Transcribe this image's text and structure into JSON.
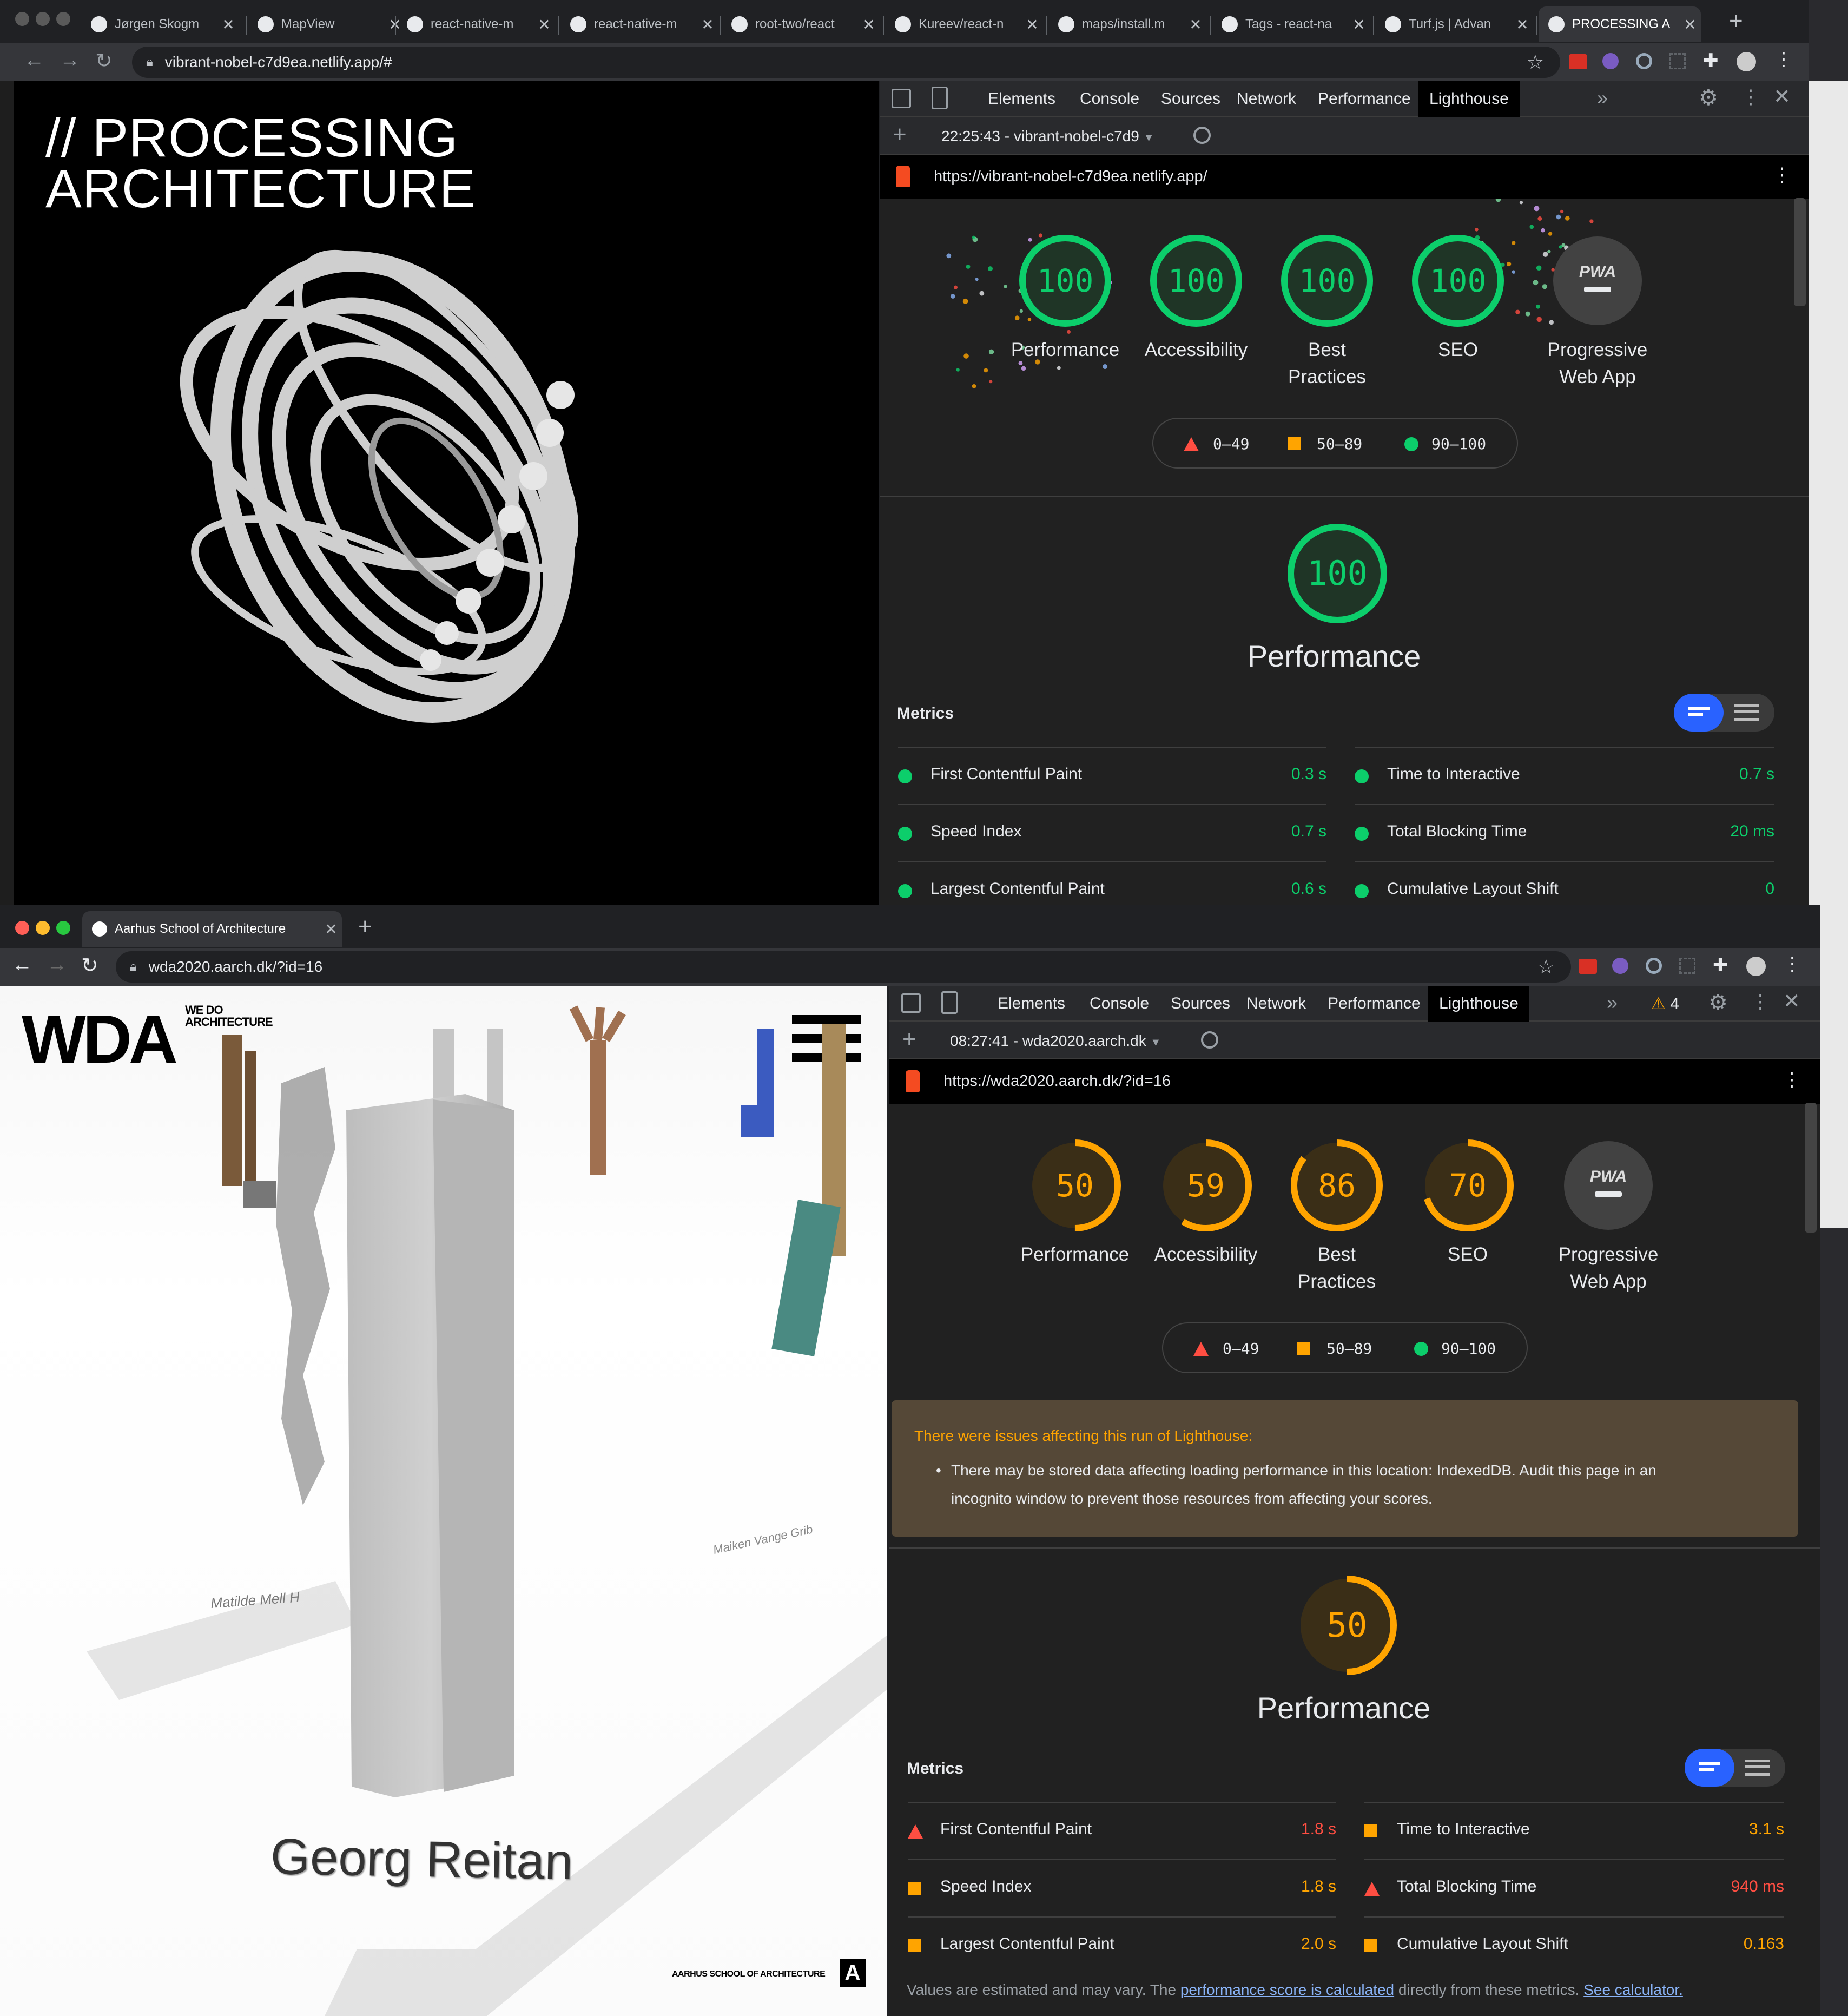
{
  "window_top": {
    "tabs": [
      {
        "label": "Jørgen Skogm",
        "icon": "gitlab-icon"
      },
      {
        "label": "MapView",
        "icon": "react-icon"
      },
      {
        "label": "react-native-m",
        "icon": "github-icon"
      },
      {
        "label": "react-native-m",
        "icon": "github-icon"
      },
      {
        "label": "root-two/react",
        "icon": "github-icon"
      },
      {
        "label": "Kureev/react-n",
        "icon": "github-icon"
      },
      {
        "label": "maps/install.m",
        "icon": "github-icon"
      },
      {
        "label": "Tags - react-na",
        "icon": "github-icon"
      },
      {
        "label": "Turf.js | Advan",
        "icon": "turf-icon"
      },
      {
        "label": "PROCESSING A",
        "icon": "square-icon"
      }
    ],
    "url": "vibrant-nobel-c7d9ea.netlify.app/#",
    "page": {
      "title_line1": "// PROCESSING",
      "title_line2": "ARCHITECTURE"
    },
    "devtools": {
      "tabs": [
        "Elements",
        "Console",
        "Sources",
        "Network",
        "Performance",
        "Lighthouse"
      ],
      "active_tab": "Lighthouse",
      "report_time": "22:25:43 - vibrant-nobel-c7d9",
      "report_url": "https://vibrant-nobel-c7d9ea.netlify.app/",
      "scores": [
        {
          "value": "100",
          "label1": "Performance",
          "label2": "",
          "color": "#0cce6b",
          "fraction": 1.0
        },
        {
          "value": "100",
          "label1": "Accessibility",
          "label2": "",
          "color": "#0cce6b",
          "fraction": 1.0
        },
        {
          "value": "100",
          "label1": "Best",
          "label2": "Practices",
          "color": "#0cce6b",
          "fraction": 1.0
        },
        {
          "value": "100",
          "label1": "SEO",
          "label2": "",
          "color": "#0cce6b",
          "fraction": 1.0
        }
      ],
      "pwa": {
        "badge": "PWA",
        "label1": "Progressive",
        "label2": "Web App"
      },
      "legend": [
        "0–49",
        "50–89",
        "90–100"
      ],
      "perf_score": "100",
      "perf_title": "Performance",
      "metrics_heading": "Metrics",
      "metrics": [
        {
          "label": "First Contentful Paint",
          "value": "0.3 s",
          "status": "pass"
        },
        {
          "label": "Time to Interactive",
          "value": "0.7 s",
          "status": "pass"
        },
        {
          "label": "Speed Index",
          "value": "0.7 s",
          "status": "pass"
        },
        {
          "label": "Total Blocking Time",
          "value": "20 ms",
          "status": "pass"
        },
        {
          "label": "Largest Contentful Paint",
          "value": "0.6 s",
          "status": "pass"
        },
        {
          "label": "Cumulative Layout Shift",
          "value": "0",
          "status": "pass"
        }
      ]
    }
  },
  "window_bottom": {
    "tabs": [
      {
        "label": "Aarhus School of Architecture",
        "icon": "wda-icon"
      }
    ],
    "url": "wda2020.aarch.dk/?id=16",
    "page": {
      "logo": "WDA",
      "logo_sub1": "WE DO",
      "logo_sub2": "ARCHITECTURE",
      "name": "Georg Reitan",
      "footer": "AARHUS SCHOOL OF ARCHITECTURE",
      "floor_label1": "Matilde Mell H",
      "floor_label2": "Maiken Vange Grib"
    },
    "devtools": {
      "tabs": [
        "Elements",
        "Console",
        "Sources",
        "Network",
        "Performance",
        "Lighthouse"
      ],
      "active_tab": "Lighthouse",
      "warning_count": "4",
      "report_time": "08:27:41 - wda2020.aarch.dk",
      "report_url": "https://wda2020.aarch.dk/?id=16",
      "scores": [
        {
          "value": "50",
          "label1": "Performance",
          "label2": "",
          "color": "#ffa400",
          "fraction": 0.5
        },
        {
          "value": "59",
          "label1": "Accessibility",
          "label2": "",
          "color": "#ffa400",
          "fraction": 0.59
        },
        {
          "value": "86",
          "label1": "Best",
          "label2": "Practices",
          "color": "#ffa400",
          "fraction": 0.86
        },
        {
          "value": "70",
          "label1": "SEO",
          "label2": "",
          "color": "#ffa400",
          "fraction": 0.7
        }
      ],
      "pwa": {
        "badge": "PWA",
        "label1": "Progressive",
        "label2": "Web App"
      },
      "legend": [
        "0–49",
        "50–89",
        "90–100"
      ],
      "warning_title": "There were issues affecting this run of Lighthouse:",
      "warning_item1": "There may be stored data affecting loading performance in this location: IndexedDB. Audit this page in an",
      "warning_item2": "incognito window to prevent those resources from affecting your scores.",
      "perf_score": "50",
      "perf_title": "Performance",
      "metrics_heading": "Metrics",
      "metrics": [
        {
          "label": "First Contentful Paint",
          "value": "1.8 s",
          "status": "fail"
        },
        {
          "label": "Time to Interactive",
          "value": "3.1 s",
          "status": "average"
        },
        {
          "label": "Speed Index",
          "value": "1.8 s",
          "status": "average"
        },
        {
          "label": "Total Blocking Time",
          "value": "940 ms",
          "status": "fail"
        },
        {
          "label": "Largest Contentful Paint",
          "value": "2.0 s",
          "status": "average"
        },
        {
          "label": "Cumulative Layout Shift",
          "value": "0.163",
          "status": "average"
        }
      ],
      "footnote_pre": "Values are estimated and may vary. The ",
      "footnote_link1": "performance score is calculated",
      "footnote_mid": " directly from these metrics. ",
      "footnote_link2": "See calculator."
    }
  },
  "colors": {
    "pass": "#0cce6b",
    "average": "#ffa400",
    "fail": "#ff4e42",
    "toggle": "#2962ff"
  }
}
